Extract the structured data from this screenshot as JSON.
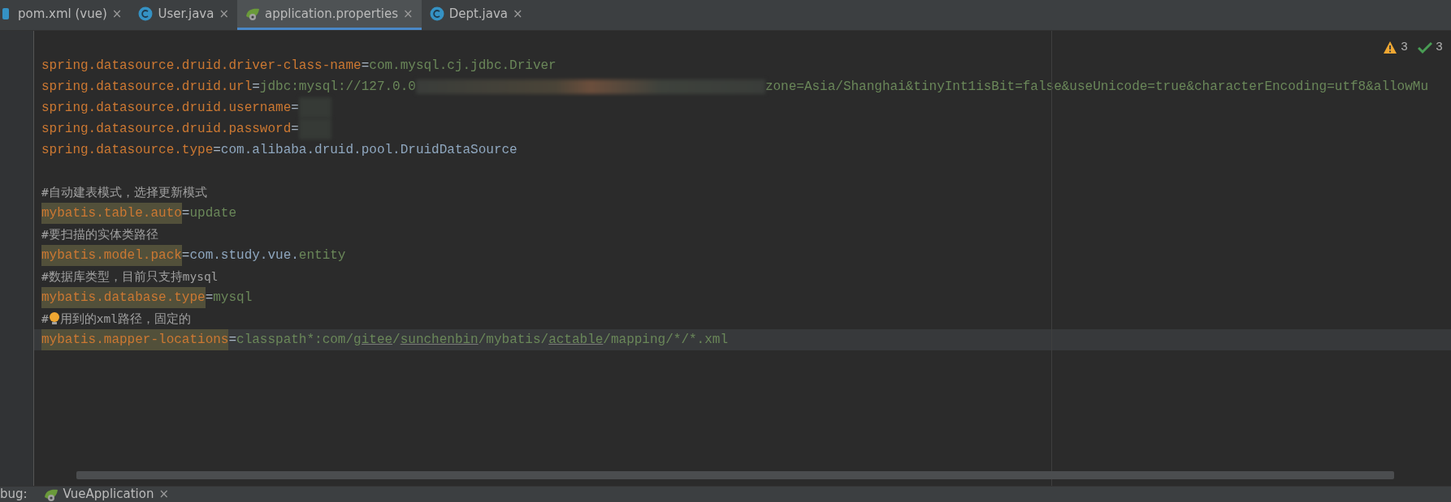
{
  "tabs": [
    {
      "label": "pom.xml (vue)",
      "kind": "maven",
      "selected": false,
      "close": "×"
    },
    {
      "label": "User.java",
      "kind": "java",
      "selected": false,
      "close": "×"
    },
    {
      "label": "application.properties",
      "kind": "properties",
      "selected": true,
      "close": "×"
    },
    {
      "label": "Dept.java",
      "kind": "java",
      "selected": false,
      "close": "×"
    }
  ],
  "inspections": [
    {
      "kind": "warning",
      "count": "3"
    },
    {
      "kind": "ok",
      "count": "3"
    }
  ],
  "lines": [
    {
      "current": false,
      "segments": [
        {
          "kind": "key",
          "text": "spring.datasource.druid.driver-class-name"
        },
        {
          "kind": "eq",
          "text": "="
        },
        {
          "kind": "value",
          "text": "com.mysql.cj.jdbc.Driver"
        }
      ]
    },
    {
      "current": false,
      "segments": [
        {
          "kind": "key",
          "text": "spring.datasource.druid.url"
        },
        {
          "kind": "eq",
          "text": "="
        },
        {
          "kind": "value",
          "text": "jdbc:mysql://127.0.0"
        },
        {
          "kind": "redacted"
        },
        {
          "kind": "value",
          "text": "zone=Asia/Shanghai&tinyInt1isBit=false&useUnicode=true&characterEncoding=utf8&allowMu"
        }
      ]
    },
    {
      "current": false,
      "segments": [
        {
          "kind": "key",
          "text": "spring.datasource.druid.username"
        },
        {
          "kind": "eq",
          "text": "="
        },
        {
          "kind": "redacted"
        }
      ]
    },
    {
      "current": false,
      "segments": [
        {
          "kind": "key",
          "text": "spring.datasource.druid.password"
        },
        {
          "kind": "eq",
          "text": "="
        },
        {
          "kind": "redacted"
        }
      ]
    },
    {
      "current": false,
      "segments": [
        {
          "kind": "key",
          "text": "spring.datasource.type"
        },
        {
          "kind": "eq",
          "text": "="
        },
        {
          "kind": "classref",
          "text": "com.alibaba.druid.pool.DruidDataSource"
        }
      ]
    },
    {
      "current": false
    },
    {
      "current": false,
      "segments": [
        {
          "kind": "comment",
          "text": "#自动建表模式，选择更新模式"
        }
      ]
    },
    {
      "current": false,
      "segments": [
        {
          "kind": "key",
          "text": "mybatis.table.auto",
          "highlighted": true
        },
        {
          "kind": "eq",
          "text": "="
        },
        {
          "kind": "value",
          "text": "update"
        }
      ]
    },
    {
      "current": false,
      "segments": [
        {
          "kind": "comment",
          "text": "#要扫描的实体类路径"
        }
      ]
    },
    {
      "current": false,
      "segments": [
        {
          "kind": "key",
          "text": "mybatis.model.pack",
          "highlighted": true
        },
        {
          "kind": "eq",
          "text": "="
        },
        {
          "kind": "classref",
          "text": "com.study.vue."
        },
        {
          "kind": "value",
          "text": "entity"
        }
      ]
    },
    {
      "current": false,
      "segments": [
        {
          "kind": "comment",
          "text": "#数据库类型，目前只支持mysql"
        }
      ]
    },
    {
      "current": false,
      "segments": [
        {
          "kind": "key",
          "text": "mybatis.database.type",
          "highlighted": true
        },
        {
          "kind": "eq",
          "text": "="
        },
        {
          "kind": "value",
          "text": "mysql"
        }
      ]
    },
    {
      "current": false,
      "segments": [
        {
          "kind": "comment",
          "text": "#"
        },
        {
          "kind": "bulb"
        },
        {
          "kind": "comment",
          "text": "用到的xml路径，固定的"
        }
      ]
    },
    {
      "current": true,
      "segments": [
        {
          "kind": "key",
          "text": "mybatis.mapper-locations",
          "highlighted": true
        },
        {
          "kind": "eq",
          "text": "="
        },
        {
          "kind": "value",
          "text": "classpath*:com/"
        },
        {
          "kind": "value",
          "text": "gitee",
          "typo": true
        },
        {
          "kind": "value",
          "text": "/"
        },
        {
          "kind": "value",
          "text": "sunchenbin",
          "typo": true
        },
        {
          "kind": "value",
          "text": "/mybatis/"
        },
        {
          "kind": "value",
          "text": "actable",
          "typo": true
        },
        {
          "kind": "value",
          "text": "/mapping/*/*.xml"
        }
      ]
    }
  ],
  "bottom": {
    "label": "bug:",
    "run_tab": {
      "label": "VueApplication",
      "close": "×"
    }
  }
}
